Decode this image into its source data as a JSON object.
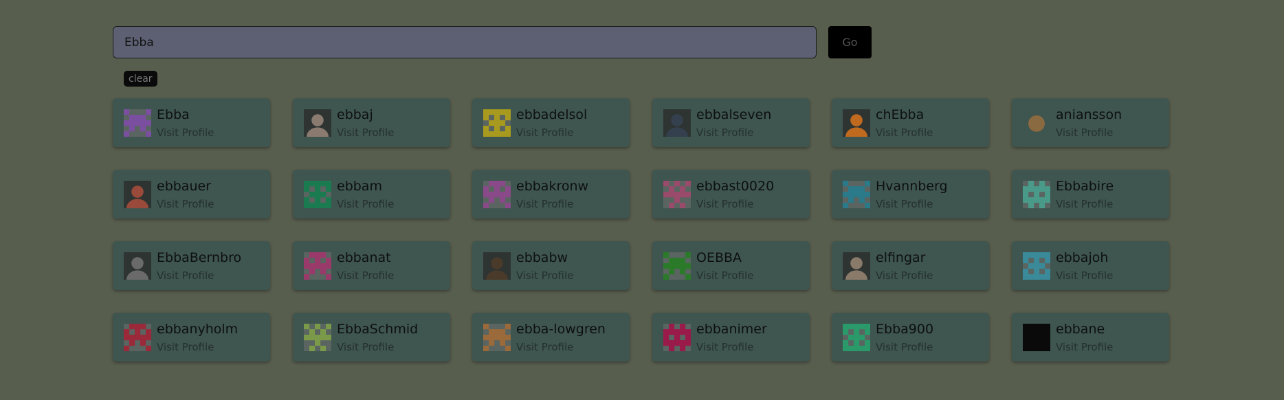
{
  "search": {
    "value": "Ebba",
    "go_label": "Go",
    "clear_label": "clear"
  },
  "visit_label": "Visit Profile",
  "users": [
    {
      "name": "Ebba",
      "avatar": "identicon",
      "color": "#7a4fa0"
    },
    {
      "name": "ebbaj",
      "avatar": "photo",
      "color": "#8a7a70"
    },
    {
      "name": "ebbadelsol",
      "avatar": "identicon",
      "color": "#a89a1e"
    },
    {
      "name": "ebbalseven",
      "avatar": "photo",
      "color": "#34404e"
    },
    {
      "name": "chEbba",
      "avatar": "photo",
      "color": "#c06a20"
    },
    {
      "name": "aniansson",
      "avatar": "emoji",
      "color": "#8a6a40"
    },
    {
      "name": "ebbauer",
      "avatar": "photo",
      "color": "#9a4a3a"
    },
    {
      "name": "ebbam",
      "avatar": "identicon",
      "color": "#1a7a50"
    },
    {
      "name": "ebbakronw",
      "avatar": "identicon",
      "color": "#8a4a8a"
    },
    {
      "name": "ebbast0020",
      "avatar": "identicon",
      "color": "#9a4a6a"
    },
    {
      "name": "Hvannberg",
      "avatar": "identicon",
      "color": "#2a7a8a"
    },
    {
      "name": "Ebbabire",
      "avatar": "identicon",
      "color": "#4a9a8a"
    },
    {
      "name": "EbbaBernbro",
      "avatar": "photo",
      "color": "#6a6a6a"
    },
    {
      "name": "ebbanat",
      "avatar": "identicon",
      "color": "#9a3a6a"
    },
    {
      "name": "ebbabw",
      "avatar": "photo",
      "color": "#4a3a2a"
    },
    {
      "name": "OEBBA",
      "avatar": "identicon",
      "color": "#2a7a2a"
    },
    {
      "name": "elfingar",
      "avatar": "photo",
      "color": "#8a7a6a"
    },
    {
      "name": "ebbajoh",
      "avatar": "identicon",
      "color": "#3a8a9a"
    },
    {
      "name": "ebbanyholm",
      "avatar": "identicon",
      "color": "#9a2a3a"
    },
    {
      "name": "EbbaSchmid",
      "avatar": "identicon",
      "color": "#7a9a4a"
    },
    {
      "name": "ebba-lowgren",
      "avatar": "identicon",
      "color": "#9a6a3a"
    },
    {
      "name": "ebbanimer",
      "avatar": "identicon",
      "color": "#9a1a4a"
    },
    {
      "name": "Ebba900",
      "avatar": "identicon",
      "color": "#2a9a6a"
    },
    {
      "name": "ebbane",
      "avatar": "dark",
      "color": "#0a0a0a"
    }
  ]
}
